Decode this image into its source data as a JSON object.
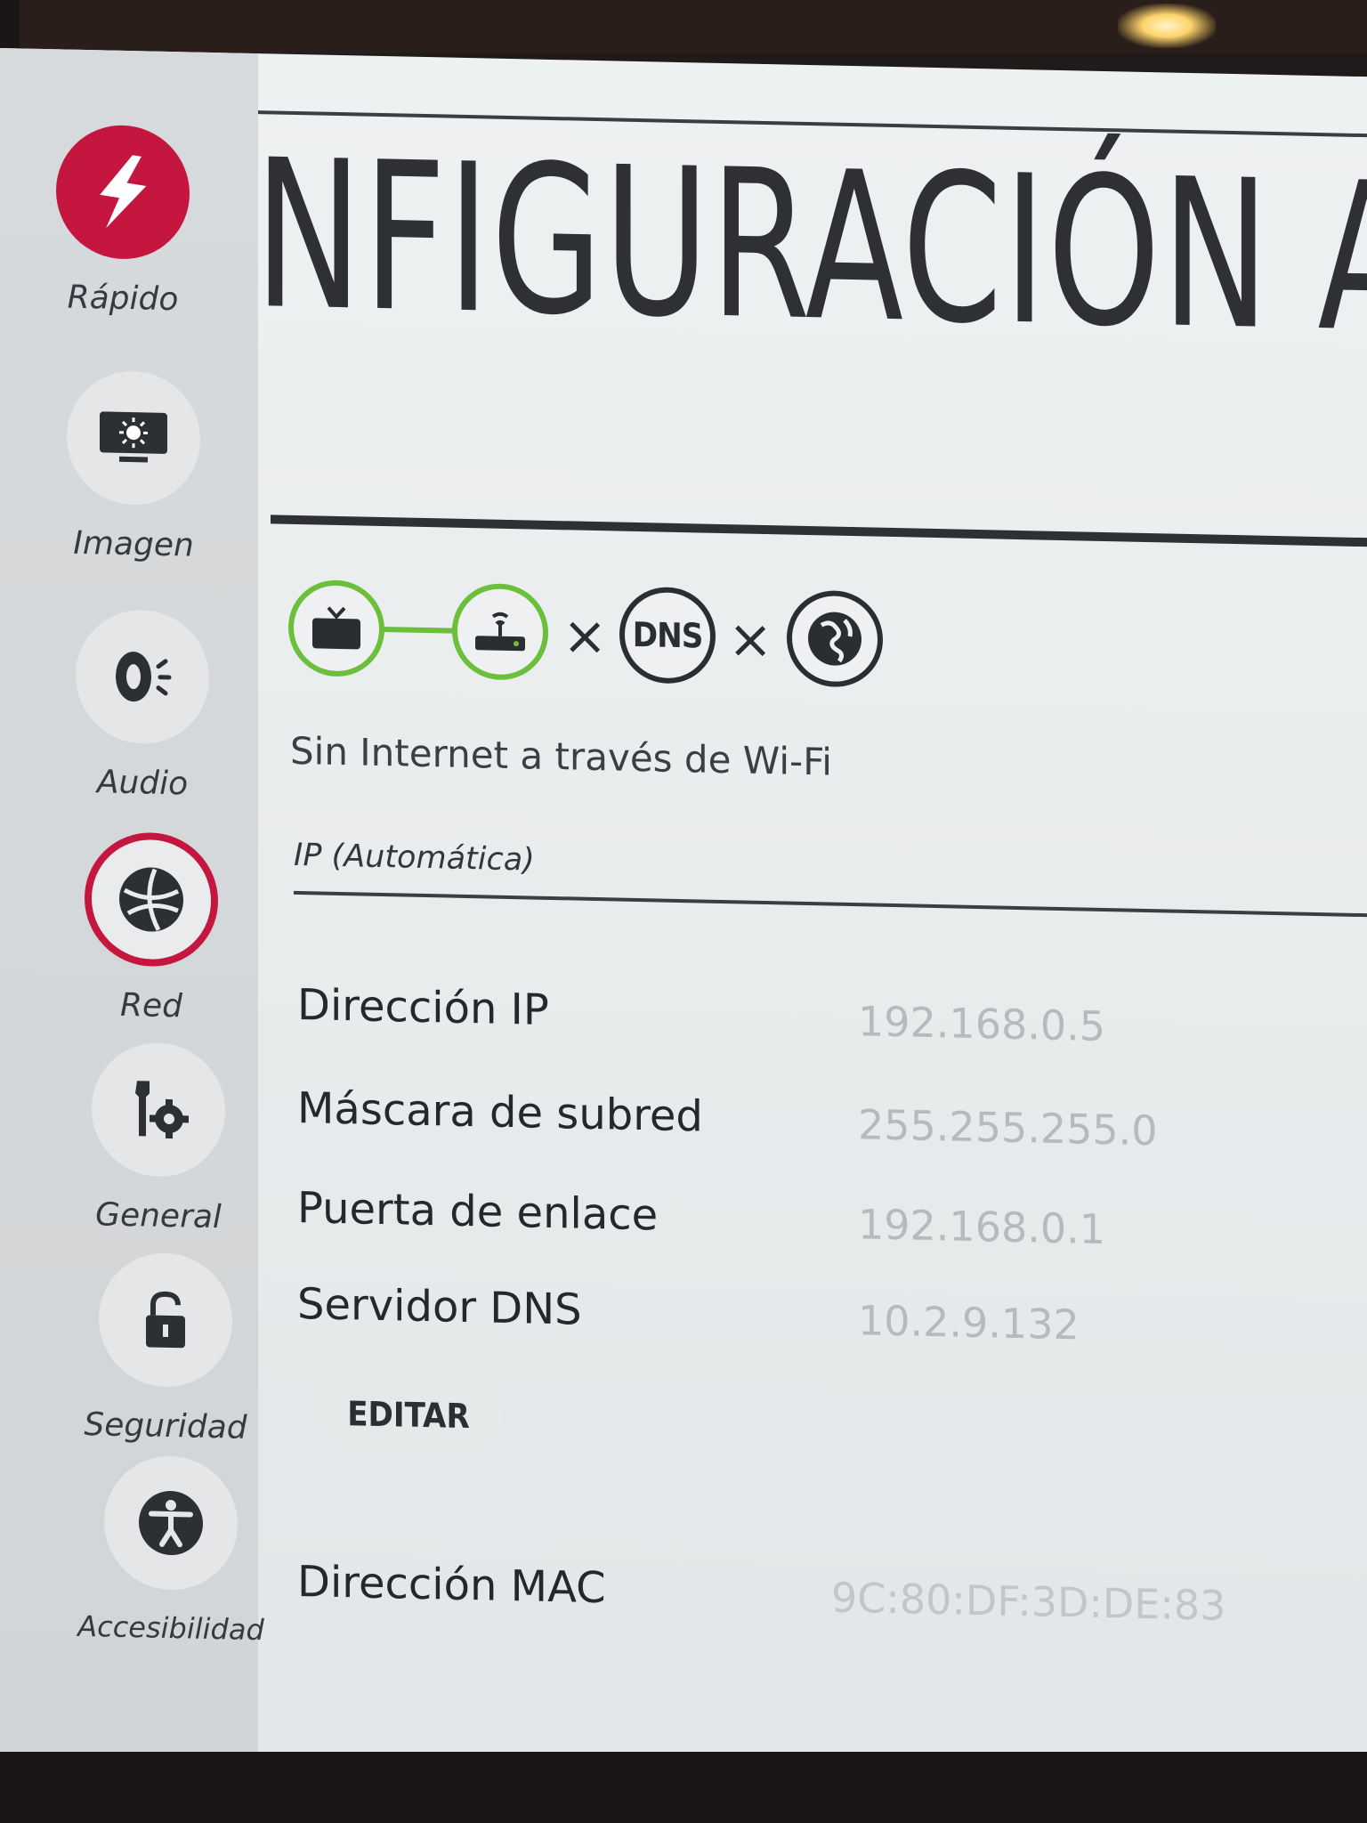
{
  "sidebar": {
    "items": [
      {
        "label": "Rápido",
        "icon": "lightning-icon",
        "state": "highlighted"
      },
      {
        "label": "Imagen",
        "icon": "picture-icon"
      },
      {
        "label": "Audio",
        "icon": "speaker-icon"
      },
      {
        "label": "Red",
        "icon": "globe-icon",
        "state": "selected"
      },
      {
        "label": "General",
        "icon": "wrench-gear-icon"
      },
      {
        "label": "Seguridad",
        "icon": "lock-icon"
      },
      {
        "label": "Accesibilidad",
        "icon": "accessibility-icon"
      }
    ]
  },
  "main": {
    "title": "NFIGURACIÓN A",
    "status": {
      "nodes": [
        {
          "icon": "tv-icon",
          "state": "ok"
        },
        {
          "icon": "router-icon",
          "state": "ok"
        },
        {
          "label": "DNS",
          "icon": "dns-icon",
          "state": "fail"
        },
        {
          "icon": "internet-globe-icon",
          "state": "fail"
        }
      ],
      "separator": "×",
      "message": "Sin Internet a través de Wi-Fi"
    },
    "section_title": "IP (Automática)",
    "rows": [
      {
        "label": "Dirección IP",
        "value": "192.168.0.5"
      },
      {
        "label": "Máscara de subred",
        "value": "255.255.255.0"
      },
      {
        "label": "Puerta de enlace",
        "value": "192.168.0.1"
      },
      {
        "label": "Servidor DNS",
        "value": "10.2.9.132"
      }
    ],
    "edit_button": "EDITAR",
    "mac": {
      "label": "Dirección MAC",
      "value": "9C:80:DF:3D:DE:83"
    }
  },
  "colors": {
    "accent_red": "#c4163e",
    "ok_green": "#6bbf3a",
    "text_dark": "#24272b",
    "value_gray": "#b6babd"
  }
}
